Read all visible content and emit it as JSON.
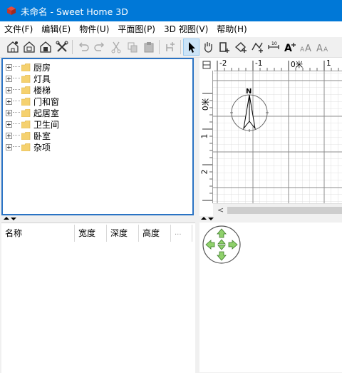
{
  "window": {
    "title": "未命名 - Sweet Home 3D"
  },
  "menu": [
    "文件(F)",
    "编辑(E)",
    "物件(U)",
    "平面图(P)",
    "3D 视图(V)",
    "帮助(H)"
  ],
  "toolbar": [
    "new-home-icon",
    "open-icon",
    "save-icon",
    "preferences-icon",
    "undo-icon",
    "redo-icon",
    "cut-icon",
    "copy-icon",
    "paste-icon",
    "add-furniture-icon",
    "select-icon",
    "pan-icon",
    "create-walls-icon",
    "create-rooms-icon",
    "create-polylines-icon",
    "create-dimensions-icon",
    "add-text-icon",
    "increase-text-size-icon",
    "decrease-text-size-icon"
  ],
  "catalog": [
    "厨房",
    "灯具",
    "楼梯",
    "门和窗",
    "起居室",
    "卫生间",
    "卧室",
    "杂项"
  ],
  "furniture_table": {
    "columns": [
      "名称",
      "宽度",
      "深度",
      "高度",
      "..."
    ]
  },
  "plan": {
    "ruler_top": [
      "-2",
      "-1",
      "0米",
      "1"
    ],
    "ruler_left": [
      "0米",
      "1",
      "2"
    ],
    "compass": "N"
  },
  "colors": {
    "title_bar": "#0078d7",
    "selection_border": "#2a73c4",
    "folder": "#f5d16f",
    "navigator": "#8fd16b"
  }
}
